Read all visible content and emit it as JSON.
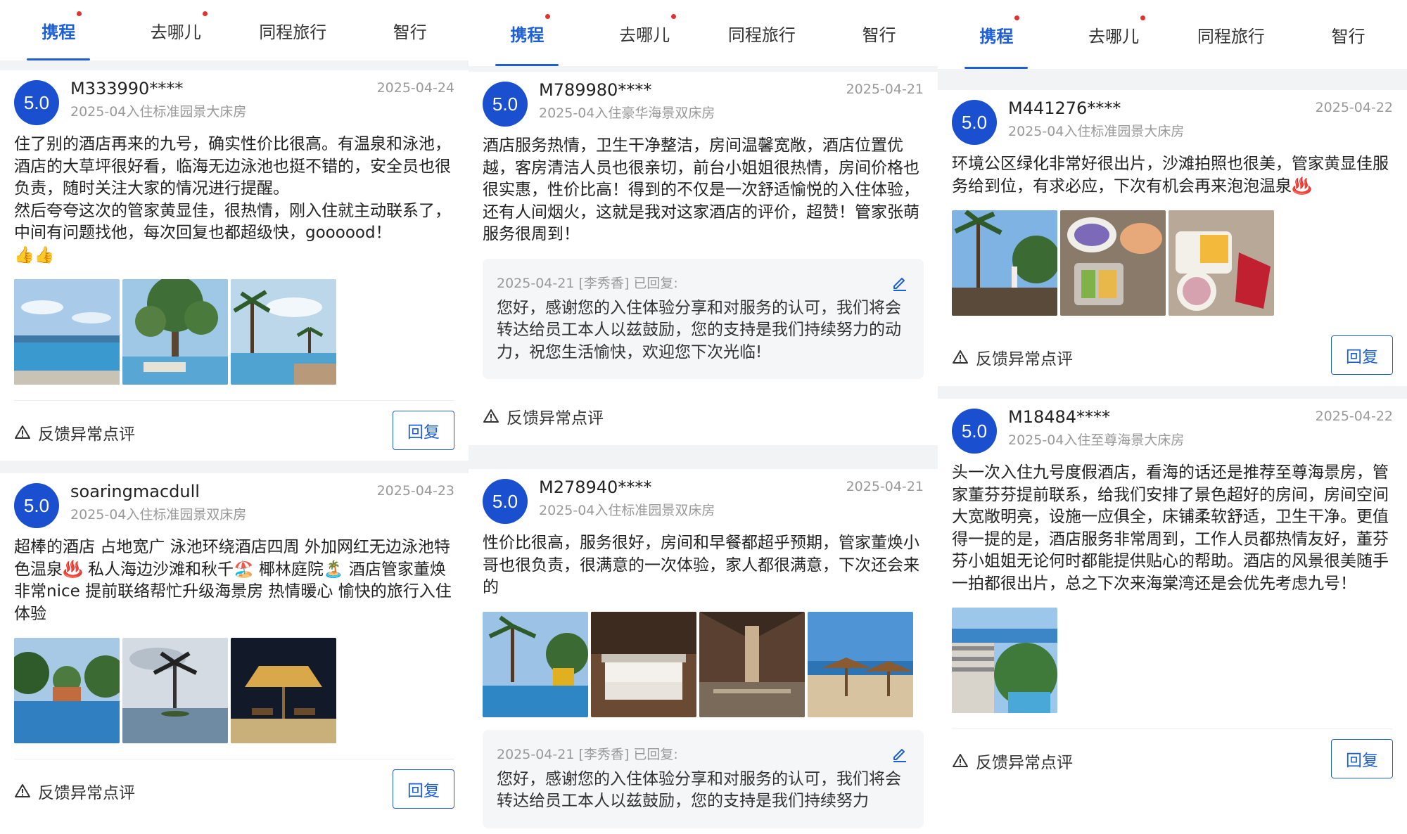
{
  "colors": {
    "accent": "#1f5fd6",
    "score_bg": "#1a4fcf",
    "dot": "#e4322f",
    "muted": "#999999"
  },
  "tabs": [
    {
      "label": "携程",
      "active": true,
      "dot": true
    },
    {
      "label": "去哪儿",
      "active": false,
      "dot": true
    },
    {
      "label": "同程旅行",
      "active": false,
      "dot": false
    },
    {
      "label": "智行",
      "active": false,
      "dot": false
    }
  ],
  "common": {
    "report_label": "反馈异常点评",
    "reply_button": "回复",
    "report_icon": "warning-triangle-icon",
    "edit_icon": "pencil-icon"
  },
  "columns": [
    {
      "reviews": [
        {
          "score": "5.0",
          "user": "M333990****",
          "date": "2025-04-24",
          "room": "2025-04入住标准园景大床房",
          "text": [
            "住了别的酒店再来的九号，确实性价比很高。有温泉和泳池，酒店的大草坪很好看，临海无边泳池也挺不错的，安全员也很负责，随时关注大家的情况进行提醒。",
            "然后夸夸这次的管家黄显佳，很热情，刚入住就主动联系了，中间有问题找他，每次回复也都超级快，goooood！",
            "👍👍"
          ],
          "photos": [
            "pool-sea",
            "tree-pool",
            "palm-pool"
          ]
        },
        {
          "score": "5.0",
          "user": "soaringmacdull",
          "date": "2025-04-23",
          "room": "2025-04入住标准园景双床房",
          "text": [
            "超棒的酒店 占地宽广 泳池环绕酒店四周 外加网红无边泳池特色温泉♨️ 私人海边沙滩和秋千🏖️ 椰林庭院🏝️ 酒店管家董焕非常nice 提前联络帮忙升级海景房 热情暖心 愉快的旅行入住体验"
          ],
          "photos": [
            "garden-pool",
            "palm-sky",
            "night-umbrella"
          ]
        }
      ]
    },
    {
      "reviews": [
        {
          "score": "5.0",
          "user": "M789980****",
          "date": "2025-04-21",
          "room": "2025-04入住豪华海景双床房",
          "text": [
            "酒店服务热情，卫生干净整洁，房间温馨宽敞，酒店位置优越，客房清洁人员也很亲切，前台小姐姐很热情，房间价格也很实惠，性价比高！得到的不仅是一次舒适愉悦的入住体验，还有人间烟火，这就是我对这家酒店的评价，超赞！管家张萌服务很周到！"
          ],
          "reply": {
            "meta": "2025-04-21 [李秀香] 已回复:",
            "text": "您好，感谢您的入住体验分享和对服务的认可，我们将会转达给员工本人以兹鼓励，您的支持是我们持续努力的动力，祝您生活愉快，欢迎您下次光临!"
          }
        },
        {
          "score": "5.0",
          "user": "M278940****",
          "date": "2025-04-21",
          "room": "2025-04入住标准园景双床房",
          "text": [
            "性价比很高，服务很好，房间和早餐都超乎预期，管家董焕小哥也很负责，很满意的一次体验，家人都很满意，下次还会来的"
          ],
          "photos": [
            "resort-pool",
            "twin-room",
            "lobby",
            "beach-umbrellas"
          ],
          "reply": {
            "meta": "2025-04-21 [李秀香] 已回复:",
            "text": "您好，感谢您的入住体验分享和对服务的认可，我们将会转达给员工本人以兹鼓励，您的支持是我们持续努力"
          }
        }
      ]
    },
    {
      "reviews": [
        {
          "score": "5.0",
          "user": "M441276****",
          "date": "2025-04-22",
          "room": "2025-04入住标准园景大床房",
          "text": [
            "环境公区绿化非常好很出片，沙滩拍照也很美，管家黄显佳服务给到位，有求必应，下次有机会再来泡泡温泉♨️"
          ],
          "photos": [
            "palm-person",
            "breakfast-bowls",
            "fruit-plate"
          ]
        },
        {
          "score": "5.0",
          "user": "M18484****",
          "date": "2025-04-22",
          "room": "2025-04入住至尊海景大床房",
          "text": [
            "头一次入住九号度假酒店，看海的话还是推荐至尊海景房，管家董芬芬提前联系，给我们安排了景色超好的房间，房间空间大宽敞明亮，设施一应俱全，床铺柔软舒适，卫生干净。更值得一提的是，酒店服务非常周到，工作人员都热情友好，董芬芬小姐姐无论何时都能提供贴心的帮助。酒店的风景很美随手一拍都很出片，总之下次来海棠湾还是会优先考虑九号！"
          ],
          "photos": [
            "sea-view-hotel"
          ]
        }
      ]
    }
  ]
}
